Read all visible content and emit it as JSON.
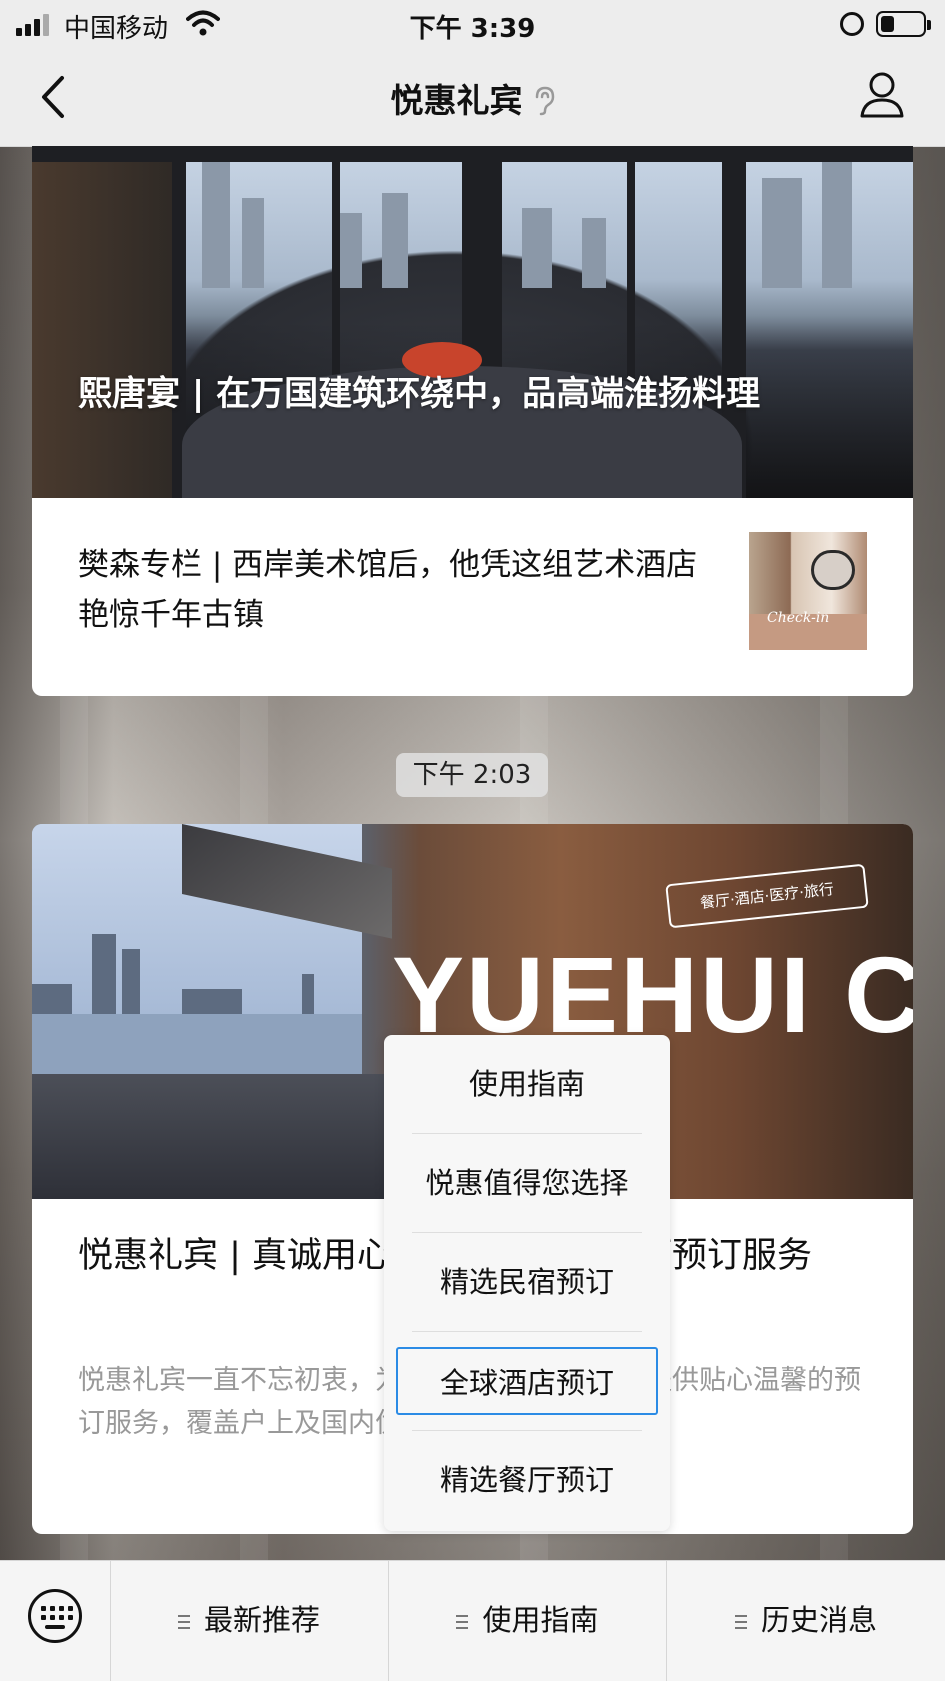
{
  "status_bar": {
    "carrier": "中国移动",
    "time": "下午 3:39"
  },
  "nav": {
    "title": "悦惠礼宾",
    "back_icon": "chevron-left-icon",
    "ear_icon": "ear-icon",
    "profile_icon": "user-icon"
  },
  "messages": [
    {
      "hero_caption": "熙唐宴 | 在万国建筑环绕中，品高端淮扬料理",
      "sub_title": "樊森专栏 | 西岸美术馆后，他凭这组艺术酒店艳惊千年古镇",
      "thumb_label": "Check-in"
    }
  ],
  "timestamp": "下午 2:03",
  "card2": {
    "banner_title": "YUEHUI CLUB",
    "banner_ribbon": "餐厅·酒店·医疗·旅行",
    "title": "悦惠礼宾 | 真诚用心，提供温馨的餐厅预订服务",
    "desc": "悦惠礼宾一直不忘初衷，为企业用户和个人贵宾提供贴心温馨的预订服务，覆盖户上及国内优秀餐厅，"
  },
  "popup_menu": {
    "items": [
      "使用指南",
      "悦惠值得您选择",
      "精选民宿预订",
      "全球酒店预订",
      "精选餐厅预订"
    ],
    "selected_index": 3
  },
  "bottom_menu": {
    "keyboard_icon": "keyboard-icon",
    "tabs": [
      "最新推荐",
      "使用指南",
      "历史消息"
    ]
  },
  "colors": {
    "bar_bg": "#ededed",
    "selection_border": "#2b8be5",
    "desc_text": "#999999"
  }
}
